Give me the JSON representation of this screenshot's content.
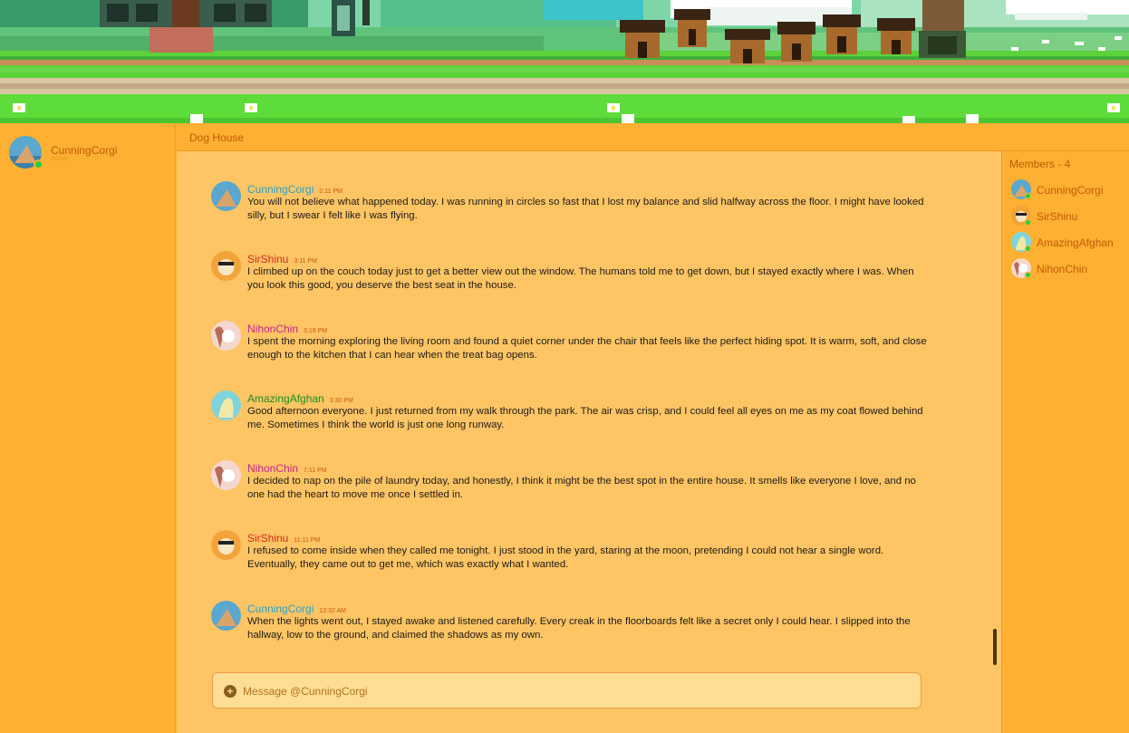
{
  "colors": {
    "accent": "#fdb031",
    "message_bg": "#ffc565",
    "online": "#23d23e",
    "author_cunningcorgi": "#2d9fc7",
    "author_sirshinu": "#d12b1d",
    "author_nihonchin": "#c2268a",
    "author_amazingafghan": "#1d8c20"
  },
  "current_user": {
    "name": "CunningCorgi",
    "status": "Active",
    "avatar_icon": "corgi-avatar-icon"
  },
  "channel": {
    "name": "Dog House"
  },
  "messages": [
    {
      "author": "CunningCorgi",
      "time": "2:11 PM",
      "text": "You will not believe what happened today. I was running in circles so fast that I lost my balance and slid halfway across the floor. I might have looked silly, but I swear I felt like I was flying."
    },
    {
      "author": "SirShinu",
      "time": "3:11 PM",
      "text": "I climbed up on the couch today just to get a better view out the window. The humans told me to get down, but I stayed exactly where I was. When you look this good, you deserve the best seat in the house."
    },
    {
      "author": "NihonChin",
      "time": "3:19 PM",
      "text": "I spent the morning exploring the living room and found a quiet corner under the chair that feels like the perfect hiding spot. It is warm, soft, and close enough to the kitchen that I can hear when the treat bag opens."
    },
    {
      "author": "AmazingAfghan",
      "time": "3:30 PM",
      "text": "Good afternoon everyone. I just returned from my walk through the park. The air was crisp, and I could feel all eyes on me as my coat flowed behind me. Sometimes I think the world is just one long runway."
    },
    {
      "author": "NihonChin",
      "time": "7:11 PM",
      "text": "I decided to nap on the pile of laundry today, and honestly, I think it might be the best spot in the entire house. It smells like everyone I love, and no one had the heart to move me once I settled in."
    },
    {
      "author": "SirShinu",
      "time": "11:11 PM",
      "text": "I refused to come inside when they called me tonight. I just stood in the yard, staring at the moon, pretending I could not hear a single word. Eventually, they came out to get me, which was exactly what I wanted."
    },
    {
      "author": "CunningCorgi",
      "time": "12:32 AM",
      "text": "When the lights went out, I stayed awake and listened carefully. Every creak in the floorboards felt like a secret only I could hear. I slipped into the hallway, low to the ground, and claimed the shadows as my own."
    }
  ],
  "composer": {
    "placeholder": "Message @CunningCorgi",
    "add_icon": "plus-circle-icon"
  },
  "members": {
    "title": "Members - 4",
    "list": [
      {
        "name": "CunningCorgi",
        "online": true
      },
      {
        "name": "SirShinu",
        "online": true
      },
      {
        "name": "AmazingAfghan",
        "online": true
      },
      {
        "name": "NihonChin",
        "online": true
      }
    ]
  }
}
